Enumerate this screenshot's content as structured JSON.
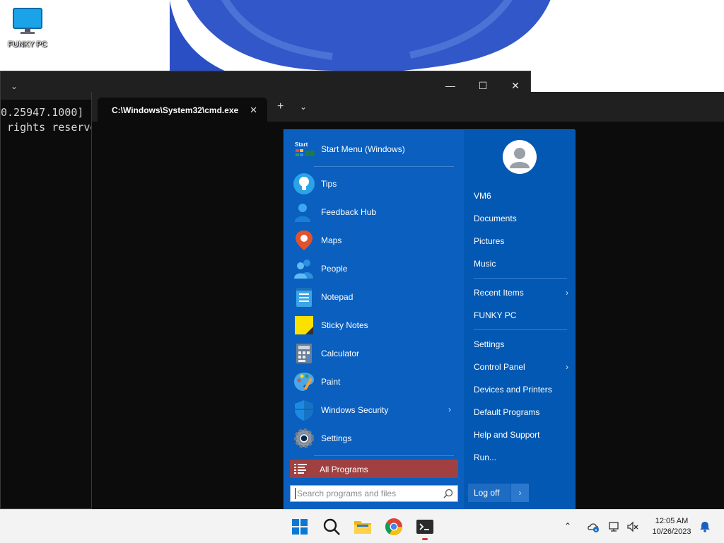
{
  "desktop": {
    "icon_label": "FUNKY PC"
  },
  "back_window": {
    "line1": "0.25947.1000]",
    "line2": " rights reserve"
  },
  "front_window": {
    "tab_title": "C:\\Windows\\System32\\cmd.exe"
  },
  "start_menu": {
    "header_title": "Start Menu (Windows)",
    "logo_text": "Start",
    "pinned_apps": [
      {
        "label": "Tips"
      },
      {
        "label": "Feedback Hub"
      },
      {
        "label": "Maps"
      },
      {
        "label": "People"
      },
      {
        "label": "Notepad"
      },
      {
        "label": "Sticky Notes"
      },
      {
        "label": "Calculator"
      },
      {
        "label": "Paint"
      },
      {
        "label": "Windows Security"
      },
      {
        "label": "Settings"
      }
    ],
    "all_programs_label": "All Programs",
    "search_placeholder": "Search programs and files",
    "right_items": [
      {
        "label": "VM6"
      },
      {
        "label": "Documents"
      },
      {
        "label": "Pictures"
      },
      {
        "label": "Music"
      },
      {
        "label": "Recent Items"
      },
      {
        "label": "FUNKY PC"
      },
      {
        "label": "Settings"
      },
      {
        "label": "Control Panel"
      },
      {
        "label": "Devices and Printers"
      },
      {
        "label": "Default Programs"
      },
      {
        "label": "Help and Support"
      },
      {
        "label": "Run..."
      }
    ],
    "logoff_label": "Log off"
  },
  "taskbar": {
    "time": "12:05 AM",
    "date": "10/26/2023",
    "icons": [
      "windows-start-icon",
      "search-icon",
      "file-explorer-icon",
      "chrome-icon",
      "terminal-icon"
    ]
  },
  "colors": {
    "start_menu_bg": "#0a5fbf",
    "all_programs_bg": "#a04040",
    "taskbar_bg": "#f3f3f3"
  }
}
